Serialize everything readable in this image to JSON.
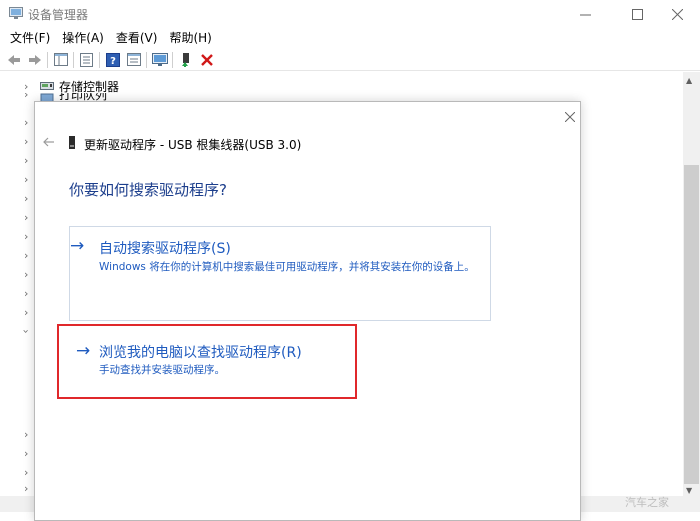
{
  "window": {
    "title": "设备管理器",
    "menu": [
      "文件(F)",
      "操作(A)",
      "查看(V)",
      "帮助(H)"
    ],
    "controls": {
      "minimize": "─",
      "maximize": "☐",
      "close": "✕"
    }
  },
  "tree": {
    "items": [
      {
        "label": "存储控制器",
        "icon": "storage-controller-icon"
      },
      {
        "label": "打印队列",
        "icon": "print-queue-icon"
      }
    ]
  },
  "dialog": {
    "title": "更新驱动程序 - USB 根集线器(USB 3.0)",
    "question": "你要如何搜索驱动程序?",
    "options": [
      {
        "arrow": "→",
        "title": "自动搜索驱动程序(S)",
        "description": "Windows 将在你的计算机中搜索最佳可用驱动程序，并将其安装在你的设备上。"
      },
      {
        "arrow": "→",
        "title": "浏览我的电脑以查找驱动程序(R)",
        "description": "手动查找并安装驱动程序。"
      }
    ],
    "close": "✕",
    "back": "←"
  },
  "watermark": "汽车之家",
  "colors": {
    "link_blue": "#1f5bbf",
    "question_blue": "#1c3e8c",
    "highlight_red": "#e0282b",
    "delete_red": "#d01818"
  }
}
